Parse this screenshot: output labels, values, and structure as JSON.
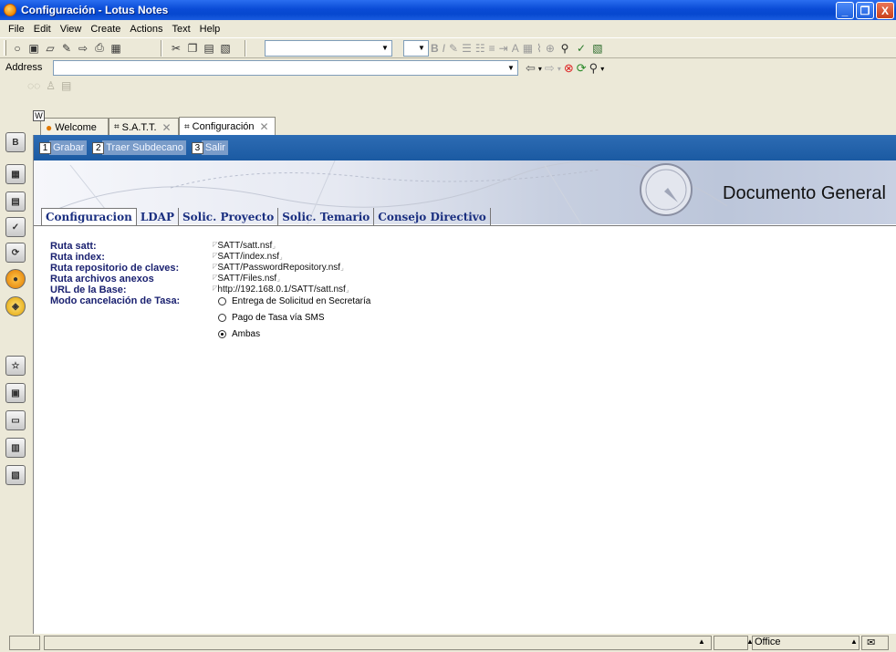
{
  "window": {
    "title": "Configuración  - Lotus Notes",
    "minimize": "_",
    "maximize": "❐",
    "close": "X"
  },
  "menu": [
    "File",
    "Edit",
    "View",
    "Create",
    "Actions",
    "Text",
    "Help"
  ],
  "address": {
    "label": "Address",
    "value": ""
  },
  "tabs": [
    {
      "label": "Welcome",
      "icon": "welcome-icon",
      "closable": false
    },
    {
      "label": "S.A.T.T.",
      "icon": "database-icon",
      "closable": true
    },
    {
      "label": "Configuración",
      "icon": "database-icon",
      "closable": true,
      "active": true
    }
  ],
  "tab_close_glyph": "✕",
  "tab_badge": "W",
  "left_badge": "B",
  "actions": [
    {
      "key": "1",
      "label": "Grabar"
    },
    {
      "key": "2",
      "label": "Traer Subdecano"
    },
    {
      "key": "3",
      "label": "Salir"
    }
  ],
  "banner_title": "Documento General",
  "doc_tabs": [
    "Configuracion",
    "LDAP",
    "Solic. Proyecto",
    "Solic. Temario",
    "Consejo Directivo"
  ],
  "fields": [
    {
      "label": "Ruta satt:",
      "value": "SATT/satt.nsf"
    },
    {
      "label": "Ruta index:",
      "value": "SATT/index.nsf"
    },
    {
      "label": "Ruta repositorio de claves:",
      "value": "SATT/PasswordRepository.nsf"
    },
    {
      "label": "Ruta archivos anexos",
      "value": "SATT/Files.nsf"
    },
    {
      "label": "URL de la Base:",
      "value": "http://192.168.0.1/SATT/satt.nsf"
    },
    {
      "label": "Modo cancelación de Tasa:",
      "value": ""
    }
  ],
  "radio_options": [
    {
      "label": "Entrega de Solicitud en Secretaría",
      "checked": false
    },
    {
      "label": "Pago de Tasa vía SMS",
      "checked": false
    },
    {
      "label": "Ambas",
      "checked": true
    }
  ],
  "status": {
    "location": "Office"
  },
  "colors": {
    "titlebar": "#0a4bd6",
    "action_bar": "#1b5aa2",
    "field_label": "#1a2170",
    "doc_tab_text": "#1a2f80"
  }
}
